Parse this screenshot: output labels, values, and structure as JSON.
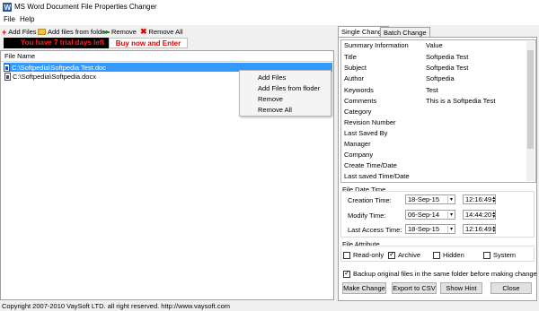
{
  "window": {
    "title": "MS Word Document File Properties Changer"
  },
  "menu": [
    "File",
    "Help"
  ],
  "toolbar": {
    "add_files": "Add Files",
    "add_folder": "Add files from folder",
    "remove": "Remove",
    "remove_all": "Remove All"
  },
  "trial": {
    "days_left": "You have 7 trial days left",
    "buy": "Buy now and Enter Key"
  },
  "file_list": {
    "header": "File Name",
    "files": [
      "C:\\Softpedia\\Softpedia Test.doc",
      "C:\\Softpedia\\Softpedia.docx"
    ]
  },
  "context_menu": [
    "Add Files",
    "Add Files from floder",
    "Remove",
    "Remove All"
  ],
  "tabs": [
    "Single Change",
    "Batch Change"
  ],
  "properties": {
    "col_info": "Summary Information",
    "col_value": "Value",
    "rows": [
      {
        "name": "Title",
        "value": "Softpedia Test"
      },
      {
        "name": "Subject",
        "value": "Softpedia Test"
      },
      {
        "name": "Author",
        "value": "Softpedia"
      },
      {
        "name": "Keywords",
        "value": "Test"
      },
      {
        "name": "Comments",
        "value": "This is a Softpedia Test"
      },
      {
        "name": "Category",
        "value": ""
      },
      {
        "name": "Revision Number",
        "value": ""
      },
      {
        "name": "Last Saved By",
        "value": ""
      },
      {
        "name": "Manager",
        "value": ""
      },
      {
        "name": "Company",
        "value": ""
      },
      {
        "name": "Create Time/Date",
        "value": ""
      },
      {
        "name": "Last saved Time/Date",
        "value": ""
      }
    ]
  },
  "file_date_time": {
    "title": "File Date Time",
    "creation": {
      "label": "Creation Time:",
      "date": "18-Sep-15",
      "time": "12:16:49"
    },
    "modify": {
      "label": "Modify Time:",
      "date": "06-Sep-14",
      "time": "14:44:20"
    },
    "access": {
      "label": "Last Access Time:",
      "date": "18-Sep-15",
      "time": "12:16:49"
    }
  },
  "file_attribute": {
    "title": "File Attribute",
    "read_only": "Read-only",
    "archive": "Archive",
    "hidden": "Hidden",
    "system": "System"
  },
  "backup": {
    "label": "Backup original files in the same folder before making change"
  },
  "buttons": {
    "make_change": "Make Change",
    "export_csv": "Export to CSV",
    "show_hint": "Show Hint",
    "close": "Close"
  },
  "status": "Copyright 2007-2010 VaySoft LTD. all right reserved. http://www.vaysoft.com",
  "colors": {
    "selection": "#3399ff",
    "trial_red": "#ff2020",
    "add_icon": "#e00000",
    "remove_icon": "#1a8c1a"
  }
}
